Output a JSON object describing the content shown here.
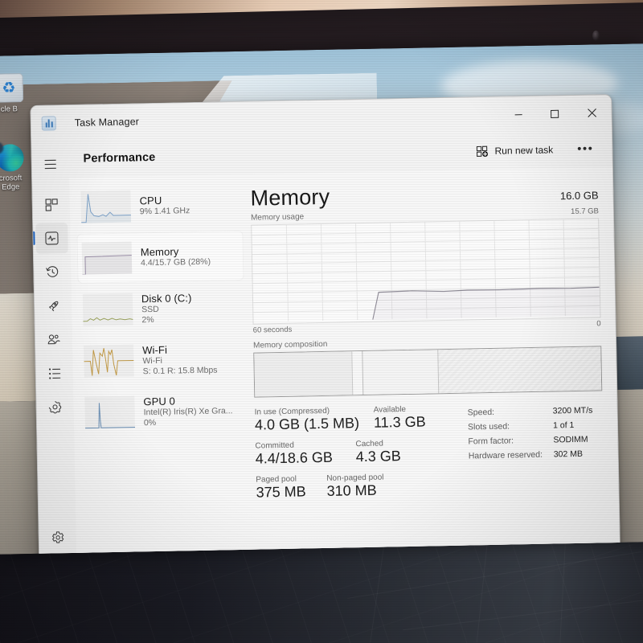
{
  "window": {
    "title": "Task Manager",
    "app_icon": "task-manager-icon",
    "minimize": "–",
    "maximize": "☐",
    "close": "✕"
  },
  "toolbar": {
    "page_title": "Performance",
    "run_new_task": "Run new task",
    "more_options": "•••"
  },
  "rail": {
    "items": [
      {
        "name": "hamburger-menu",
        "label": ""
      },
      {
        "name": "processes",
        "label": ""
      },
      {
        "name": "performance",
        "label": "",
        "selected": true
      },
      {
        "name": "app-history",
        "label": ""
      },
      {
        "name": "startup-apps",
        "label": ""
      },
      {
        "name": "users",
        "label": ""
      },
      {
        "name": "details",
        "label": ""
      },
      {
        "name": "services",
        "label": ""
      }
    ],
    "settings": "settings-gear"
  },
  "resources": [
    {
      "name": "CPU",
      "line1": "9%  1.41 GHz",
      "line2": "",
      "selected": false,
      "color": "#7fa3c9"
    },
    {
      "name": "Memory",
      "line1": "4.4/15.7 GB (28%)",
      "line2": "",
      "selected": true,
      "color": "#9b8fa8"
    },
    {
      "name": "Disk 0 (C:)",
      "line1": "SSD",
      "line2": "2%",
      "selected": false,
      "color": "#9aa35c"
    },
    {
      "name": "Wi-Fi",
      "line1": "Wi-Fi",
      "line2": "S: 0.1 R: 15.8 Mbps",
      "selected": false,
      "color": "#c29a46"
    },
    {
      "name": "GPU 0",
      "line1": "Intel(R) Iris(R) Xe Gra...",
      "line2": "0%",
      "selected": false,
      "color": "#6f93b8"
    }
  ],
  "detail": {
    "title": "Memory",
    "capacity": "16.0 GB",
    "graph_caption": "Memory usage",
    "graph_max": "15.7 GB",
    "axis_left": "60 seconds",
    "axis_right": "0",
    "composition_caption": "Memory composition"
  },
  "stats": {
    "groups": [
      {
        "labels": [
          "In use (Compressed)",
          "Available"
        ],
        "values": [
          "4.0 GB (1.5 MB)",
          "11.3 GB"
        ]
      },
      {
        "labels": [
          "Committed",
          "Cached"
        ],
        "values": [
          "4.4/18.6 GB",
          "4.3 GB"
        ]
      },
      {
        "labels": [
          "Paged pool",
          "Non-paged pool"
        ],
        "values": [
          "375 MB",
          "310 MB"
        ]
      }
    ],
    "specs": [
      {
        "key": "Speed:",
        "value": "3200 MT/s"
      },
      {
        "key": "Slots used:",
        "value": "1 of 1"
      },
      {
        "key": "Form factor:",
        "value": "SODIMM"
      },
      {
        "key": "Hardware reserved:",
        "value": "302 MB"
      }
    ]
  },
  "desktop": {
    "icons": [
      {
        "name": "recycle-bin",
        "label": "cle B"
      },
      {
        "name": "microsoft-edge",
        "label": "crosoft\nEdge"
      }
    ]
  },
  "chart_data": {
    "type": "line",
    "title": "Memory usage",
    "xlabel": "60 seconds",
    "ylabel": "GB",
    "ylim": [
      0,
      15.7
    ],
    "x": [
      0,
      10,
      20,
      30,
      34,
      36,
      40,
      50,
      60,
      70,
      80,
      90,
      100
    ],
    "values": [
      0,
      0,
      0,
      0,
      0,
      4.4,
      4.45,
      4.45,
      4.4,
      4.42,
      4.43,
      4.4,
      4.42
    ],
    "grid": true,
    "axis_right_label": "0",
    "axis_top_label": "15.7 GB"
  },
  "composition": {
    "segments": [
      {
        "name": "in-use",
        "percent": 28
      },
      {
        "name": "modified",
        "percent": 3
      },
      {
        "name": "standby",
        "percent": 22
      },
      {
        "name": "free",
        "percent": 47
      }
    ]
  },
  "colors": {
    "accent": "#1d64c4",
    "window_bg": "#f3f3f3",
    "pane_bg": "#f7f7f7",
    "text": "#1b1b1b",
    "muted": "#6b6b6b"
  }
}
